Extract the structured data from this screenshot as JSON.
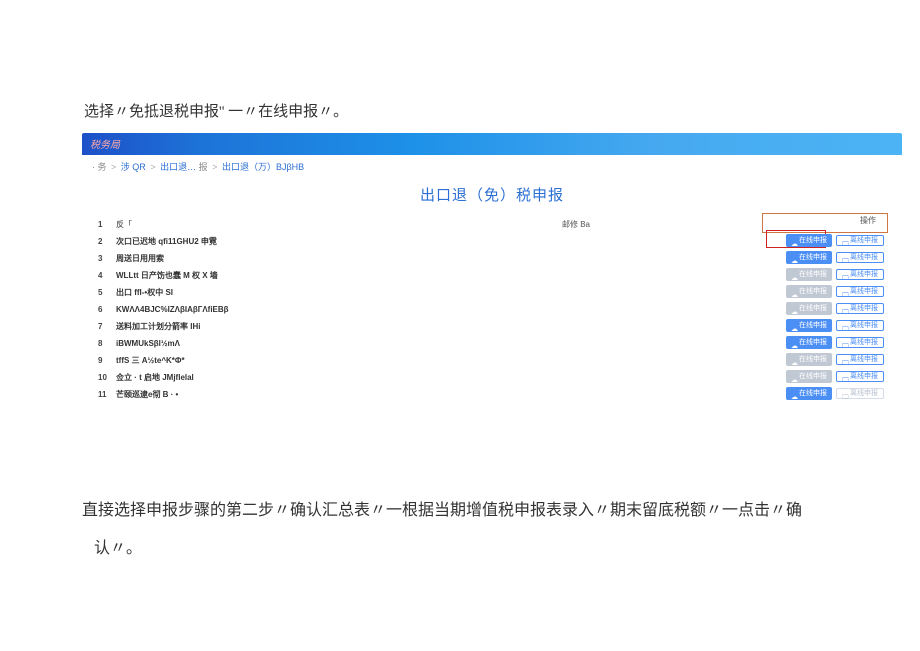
{
  "instruction_top": "选择〃免抵退税申报'' 一〃在线申报〃。",
  "system": {
    "logo": "税务局"
  },
  "breadcrumb": {
    "p1": "· 务",
    "sep": ">",
    "p2": "涉 QR",
    "p3": "出口退…",
    "p4": "报",
    "p5": "出口退（万）BJβHB"
  },
  "content_title": "出口退（免）税申报",
  "table": {
    "head_name": "反「",
    "head_mid": "邮修 Ba",
    "head_ops": "操作",
    "rows": [
      {
        "idx": "1",
        "name": "",
        "btn1_style": "disabled"
      },
      {
        "idx": "2",
        "name": "次口已迟地 qfi11GHU2 申霓",
        "btn1_style": "online"
      },
      {
        "idx": "3",
        "name": "周送日用用索",
        "btn1_style": "online"
      },
      {
        "idx": "4",
        "name": "WLLtt 日产饬也蠢 M 权 X 墙",
        "btn1_style": "disabled"
      },
      {
        "idx": "5",
        "name": "出口 ffI-•权中 SI",
        "btn1_style": "disabled"
      },
      {
        "idx": "6",
        "name": "KWΛΛ4BJC%IZΛβIAβГΛfiEBβ",
        "btn1_style": "disabled"
      },
      {
        "idx": "7",
        "name": "送料加工计划分箭率 IHi",
        "btn1_style": "online"
      },
      {
        "idx": "8",
        "name": "iBWMUkSβl½mΛ",
        "btn1_style": "online"
      },
      {
        "idx": "9",
        "name": "tffS 三 A½te^K*Φ*",
        "btn1_style": "disabled"
      },
      {
        "idx": "10",
        "name": "佥立 · t 启地 JMjflelal",
        "btn1_style": "disabled"
      },
      {
        "idx": "11",
        "name": "芒颐巡逮e彻 B ·  •",
        "btn1_style": "online",
        "offline_style": "muted"
      }
    ],
    "btn_online_label": "在线申报",
    "btn_offline_label": "离线申报"
  },
  "instruction_bottom_l1": "直接选择申报步骤的第二步〃确认汇总表〃一根据当期增值税申报表录入〃期末留底税额〃一点击〃确",
  "instruction_bottom_l2": "认〃。"
}
